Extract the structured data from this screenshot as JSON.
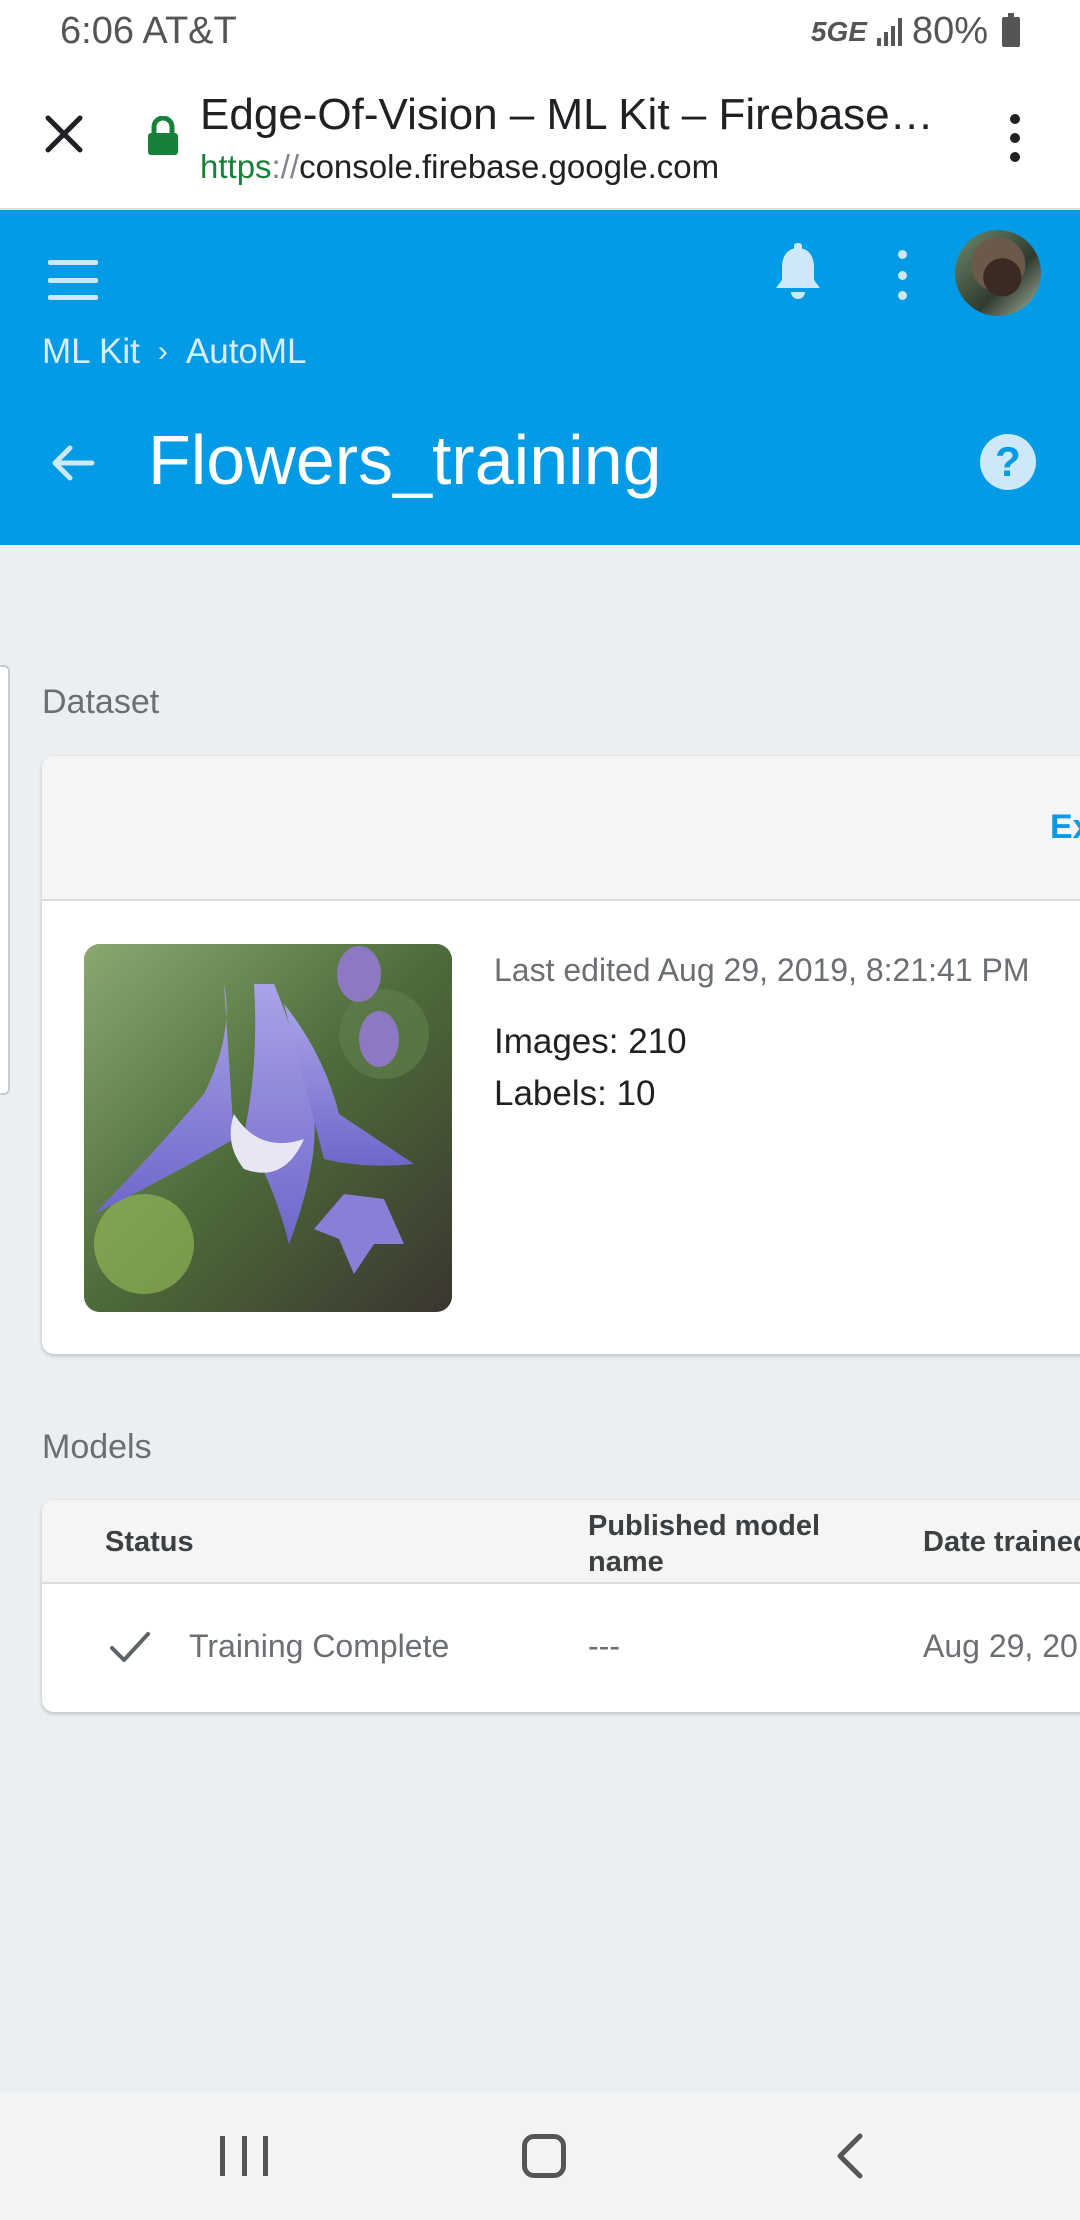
{
  "status_bar": {
    "time_carrier": "6:06 AT&T",
    "network": "5GE",
    "battery": "80%"
  },
  "browser": {
    "title": "Edge-Of-Vision – ML Kit – Firebase…",
    "url_scheme": "https",
    "url_sep": "://",
    "url_host": "console.firebase.google.com"
  },
  "header": {
    "breadcrumb": [
      "ML Kit",
      "AutoML"
    ],
    "title": "Flowers_training",
    "help_glyph": "?"
  },
  "dataset": {
    "heading": "Dataset",
    "action_label": "Ex",
    "last_edited": "Last edited Aug 29, 2019, 8:21:41 PM",
    "images": "Images: 210",
    "labels": "Labels: 10"
  },
  "models": {
    "heading": "Models",
    "columns": [
      "Status",
      "Published model name",
      "Date trained"
    ],
    "rows": [
      {
        "status": "Training Complete",
        "published": "---",
        "date": "Aug 29, 20"
      }
    ]
  },
  "icons": {
    "close": "close-icon",
    "lock": "lock-icon",
    "menu": "more-vert-icon",
    "hamburger": "menu-icon",
    "bell": "bell-icon",
    "back": "arrow-back-icon",
    "help": "help-icon",
    "check": "check-icon"
  },
  "colors": {
    "brand_blue": "#039be5",
    "background": "#eceff1",
    "secure_green": "#188038"
  }
}
